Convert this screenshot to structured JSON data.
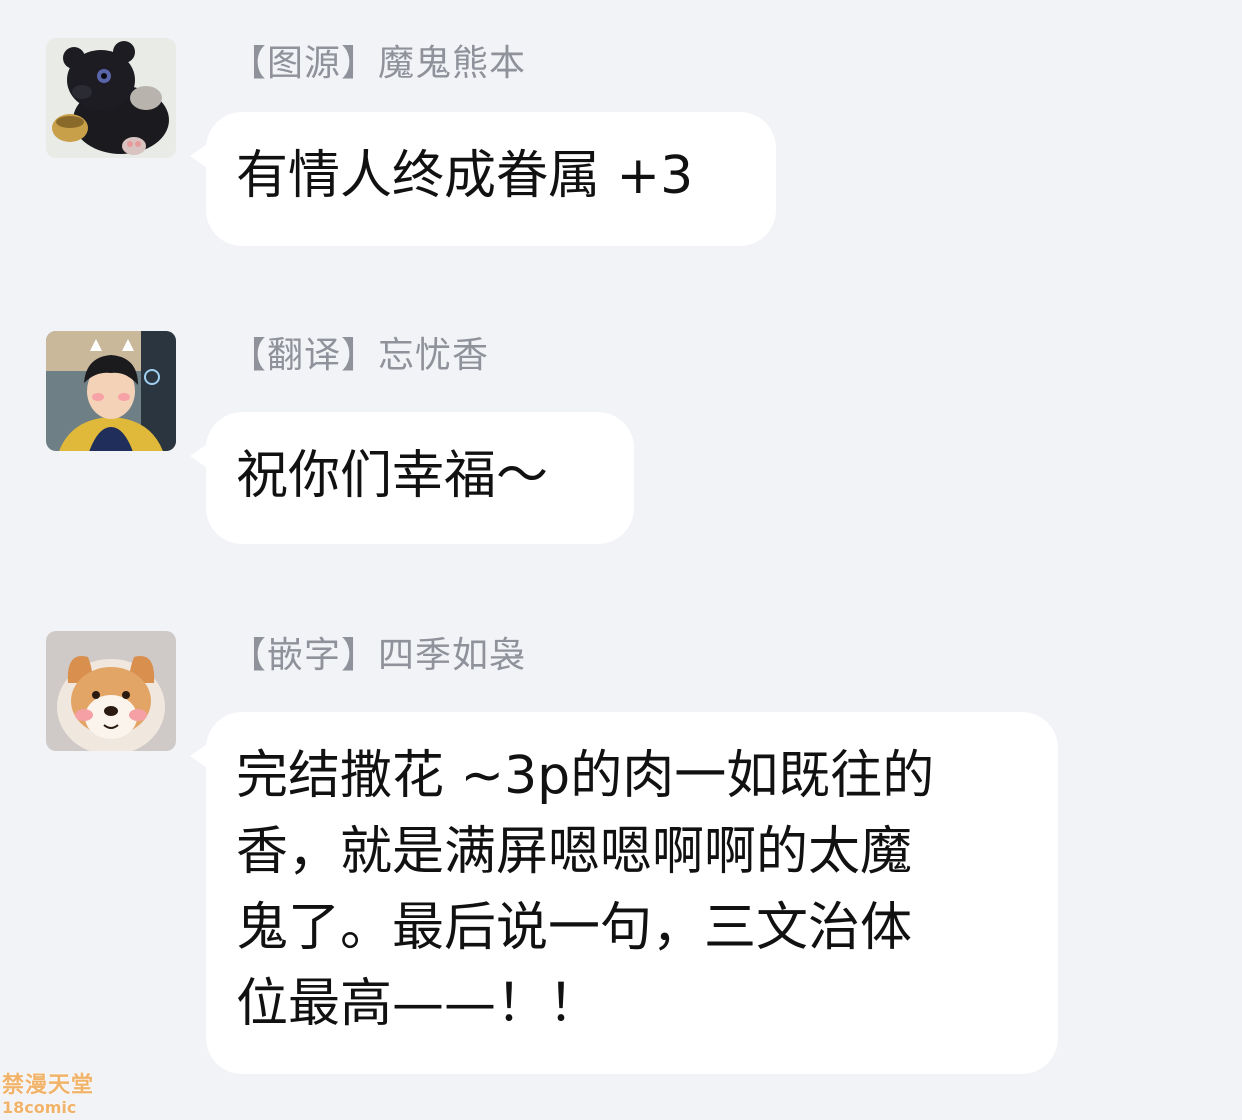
{
  "messages": [
    {
      "name": "【图源】魔鬼熊本",
      "avatar_icon": "black-bear-avatar",
      "lines": [
        "有情人终成眷属 +3"
      ]
    },
    {
      "name": "【翻译】忘忧香",
      "avatar_icon": "person-photo-avatar",
      "lines": [
        "祝你们幸福～"
      ]
    },
    {
      "name": "【嵌字】四季如袅",
      "avatar_icon": "shiba-dog-avatar",
      "lines": [
        "完结撒花 ~3p的肉一如既往的",
        "香，就是满屏嗯嗯啊啊的太魔",
        "鬼了。最后说一句，三文治体",
        "位最高——！！"
      ]
    }
  ],
  "watermark": {
    "top": "禁漫天堂",
    "bottom": "18comic"
  },
  "colors": {
    "background": "#f2f3f7",
    "bubble": "#ffffff",
    "name_text": "#8f929a",
    "message_text": "#111111",
    "watermark": "#f1b36a"
  }
}
